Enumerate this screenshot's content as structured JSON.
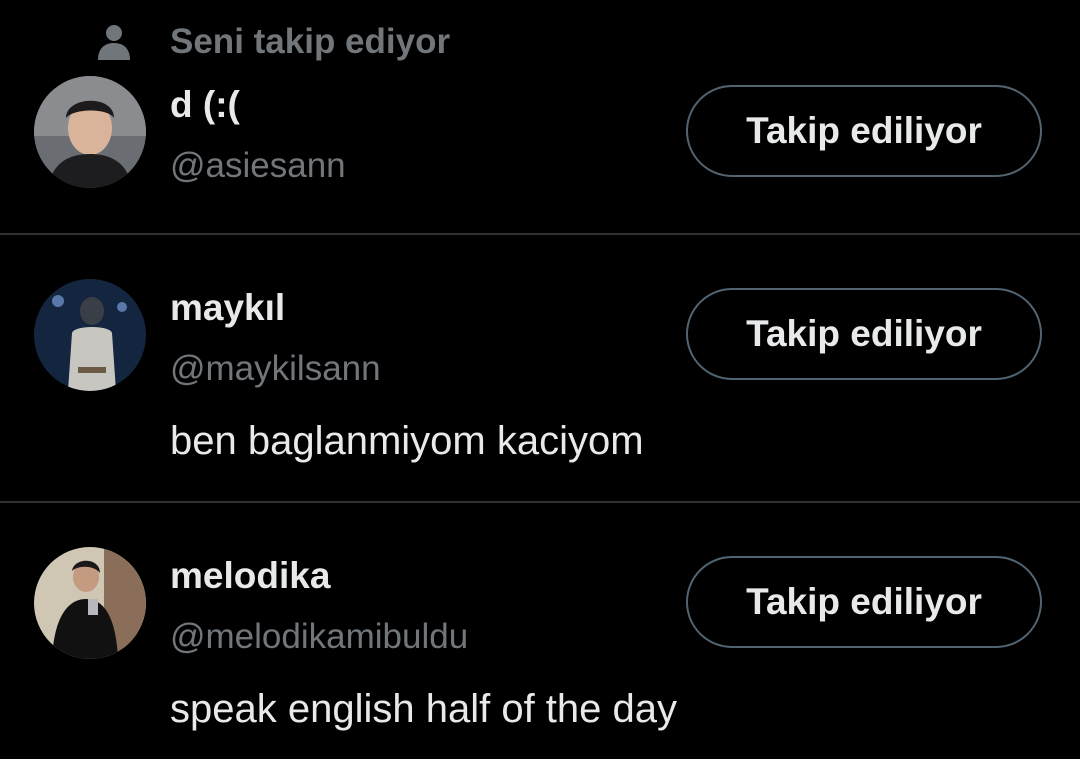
{
  "social_context": {
    "text": "Seni takip ediyor",
    "icon": "person-icon"
  },
  "users": [
    {
      "name": "d (:(",
      "handle": "@asiesann",
      "bio": "",
      "button_label": "Takip ediliyor",
      "avatar_icon": "avatar-photo"
    },
    {
      "name": "maykıl",
      "handle": "@maykilsann",
      "bio": "ben baglanmiyom kaciyom",
      "button_label": "Takip ediliyor",
      "avatar_icon": "avatar-photo"
    },
    {
      "name": "melodika",
      "handle": "@melodikamibuldu",
      "bio": "speak english half of the day",
      "button_label": "Takip ediliyor",
      "avatar_icon": "avatar-photo"
    }
  ],
  "colors": {
    "background": "#000000",
    "primary_text": "#e7e9ea",
    "secondary_text": "#71767b",
    "divider": "#2f3336",
    "button_border": "#536471"
  }
}
